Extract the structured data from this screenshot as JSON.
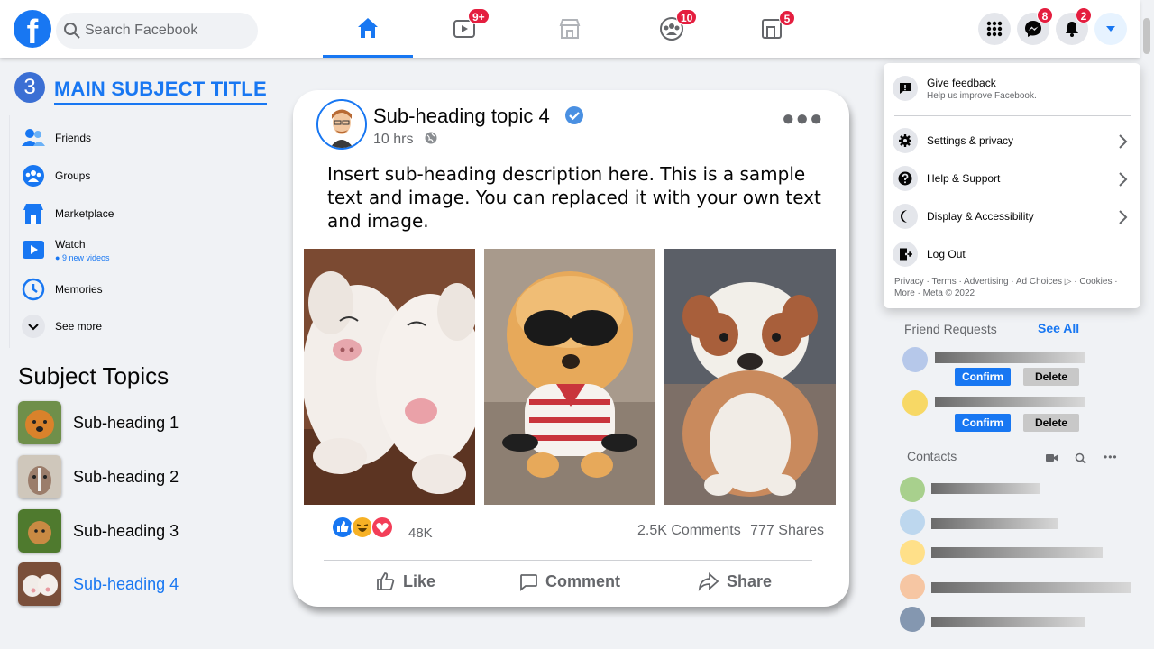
{
  "header": {
    "search_placeholder": "Search Facebook",
    "logo_letter": "f",
    "badges": {
      "watch": "9+",
      "groups": "10",
      "gaming": "5",
      "messenger": "8",
      "notifications": "2"
    }
  },
  "lesson": {
    "number": "3",
    "title": "MAIN SUBJECT TITLE"
  },
  "sidebar": {
    "items": [
      {
        "label": "Friends",
        "icon": "friends-icon"
      },
      {
        "label": "Groups",
        "icon": "groups-icon"
      },
      {
        "label": "Marketplace",
        "icon": "marketplace-icon"
      },
      {
        "label": "Watch",
        "sub": "9 new videos",
        "icon": "watch-icon"
      },
      {
        "label": "Memories",
        "icon": "memories-icon"
      },
      {
        "label": "See more",
        "icon": "chevron-down-icon"
      }
    ]
  },
  "topics": {
    "title": "Subject Topics",
    "items": [
      {
        "label": "Sub-heading 1"
      },
      {
        "label": "Sub-heading 2"
      },
      {
        "label": "Sub-heading 3"
      },
      {
        "label": "Sub-heading 4",
        "active": true
      }
    ]
  },
  "post": {
    "title": "Sub-heading topic 4",
    "time": "10 hrs",
    "text": "Insert sub-heading description here. This is a sample text and image. You can replaced it with your own text and image.",
    "reaction_count": "48K",
    "comments": "2.5K Comments",
    "shares": "777 Shares",
    "actions": {
      "like": "Like",
      "comment": "Comment",
      "share": "Share"
    }
  },
  "dropdown": {
    "feedback_title": "Give feedback",
    "feedback_sub": "Help us improve Facebook.",
    "items": [
      {
        "label": "Settings & privacy"
      },
      {
        "label": "Help & Support"
      },
      {
        "label": "Display & Accessibility"
      },
      {
        "label": "Log Out"
      }
    ],
    "footer": "Privacy · Terms · Advertising · Ad Choices ▷ · Cookies · More · Meta © 2022"
  },
  "friend_requests": {
    "title": "Friend Requests",
    "see_all": "See All",
    "confirm": "Confirm",
    "delete": "Delete"
  },
  "contacts": {
    "title": "Contacts"
  },
  "colors": {
    "accent": "#1877f2",
    "badge": "#e41e3f"
  }
}
